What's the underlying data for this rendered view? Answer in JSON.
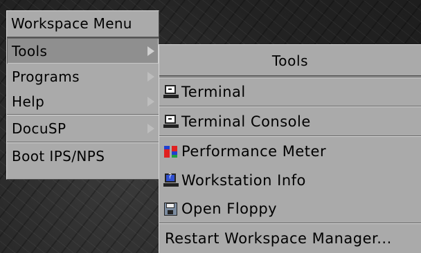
{
  "workspace_menu": {
    "title": "Workspace Menu",
    "items": [
      {
        "label": "Tools",
        "submenu": true,
        "selected": true
      },
      {
        "label": "Programs",
        "submenu": true
      },
      {
        "label": "Help",
        "submenu": true
      },
      {
        "label": "DocuSP",
        "submenu": true
      },
      {
        "label": "Boot IPS/NPS",
        "submenu": false
      }
    ]
  },
  "tools_menu": {
    "title": "Tools",
    "items": [
      {
        "label": "Terminal",
        "icon": "terminal-icon"
      },
      {
        "label": "Terminal Console",
        "icon": "terminal-icon"
      },
      {
        "label": "Performance Meter",
        "icon": "performance-meter-icon"
      },
      {
        "label": "Workstation Info",
        "icon": "workstation-info-icon"
      },
      {
        "label": "Open Floppy",
        "icon": "floppy-icon"
      },
      {
        "label": "Restart Workspace Manager...",
        "icon": null
      }
    ]
  },
  "colors": {
    "menu_bg": "#aaaaaa",
    "selected_bg": "#8f8f8f",
    "desktop_bg": "#2c2c2c"
  }
}
